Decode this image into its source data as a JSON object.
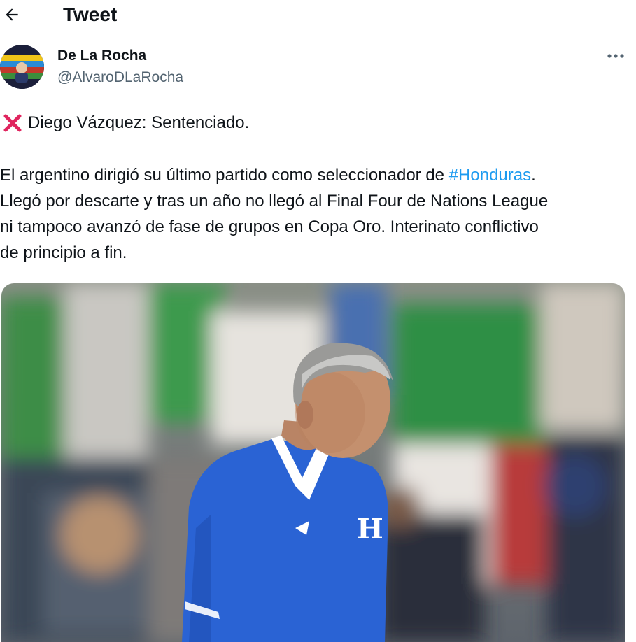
{
  "header": {
    "title": "Tweet",
    "back_icon": "arrow-left-icon"
  },
  "author": {
    "name": "De La Rocha",
    "handle": "@AlvaroDLaRocha",
    "more_icon": "more-horizontal-icon"
  },
  "tweet": {
    "headline_emoji": "cross-mark-icon",
    "headline_text": "Diego Vázquez: Sentenciado.",
    "body_line1_prefix": "El argentino dirigió su último partido como seleccionador de ",
    "hashtag": "#Honduras",
    "body_line1_suffix": ".",
    "body_line2": "Llegó por descarte y tras un año no llegó al Final Four de Nations League",
    "body_line3": "ni tampoco avanzó de fase de grupos en Copa Oro. Interinato conflictivo",
    "body_line4": "de principio a fin."
  },
  "media": {
    "icon": "photo-coach-icon"
  },
  "colors": {
    "text": "#0f1419",
    "secondary": "#536471",
    "link": "#1d9bf0",
    "cross": "#e0245e",
    "jersey": "#2a63d4"
  }
}
